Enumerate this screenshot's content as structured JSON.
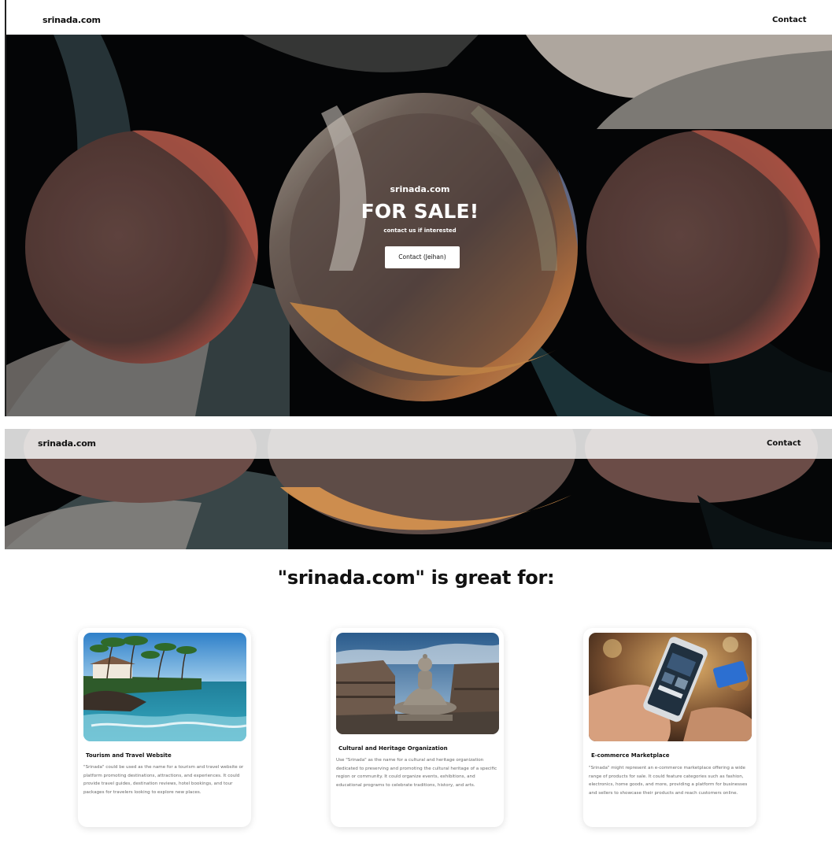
{
  "nav": {
    "brand": "srinada.com",
    "contact": "Contact"
  },
  "hero": {
    "domain": "srinada.com",
    "headline": "FOR SALE!",
    "subtext": "contact us if interested",
    "cta": "Contact (Jeihan)"
  },
  "sticky_nav": {
    "brand": "srinada.com",
    "contact": "Contact"
  },
  "section": {
    "title": "\"srinada.com\" is great for:"
  },
  "cards": [
    {
      "title": "Tourism and Travel Website",
      "text": "\"Srinada\" could be used as the name for a tourism and travel website or platform promoting destinations, attractions, and experiences. It could provide travel guides, destination reviews, hotel bookings, and tour packages for travelers looking to explore new places."
    },
    {
      "title": "Cultural and Heritage Organization",
      "text": "Use \"Srinada\" as the name for a cultural and heritage organization dedicated to preserving and promoting the cultural heritage of a specific region or community. It could organize events, exhibitions, and educational programs to celebrate traditions, history, and arts."
    },
    {
      "title": "E-commerce Marketplace",
      "text": "\"Srinada\" might represent an e-commerce marketplace offering a wide range of products for sale. It could feature categories such as fashion, electronics, home goods, and more, providing a platform for businesses and sellers to showcase their products and reach customers online."
    }
  ]
}
